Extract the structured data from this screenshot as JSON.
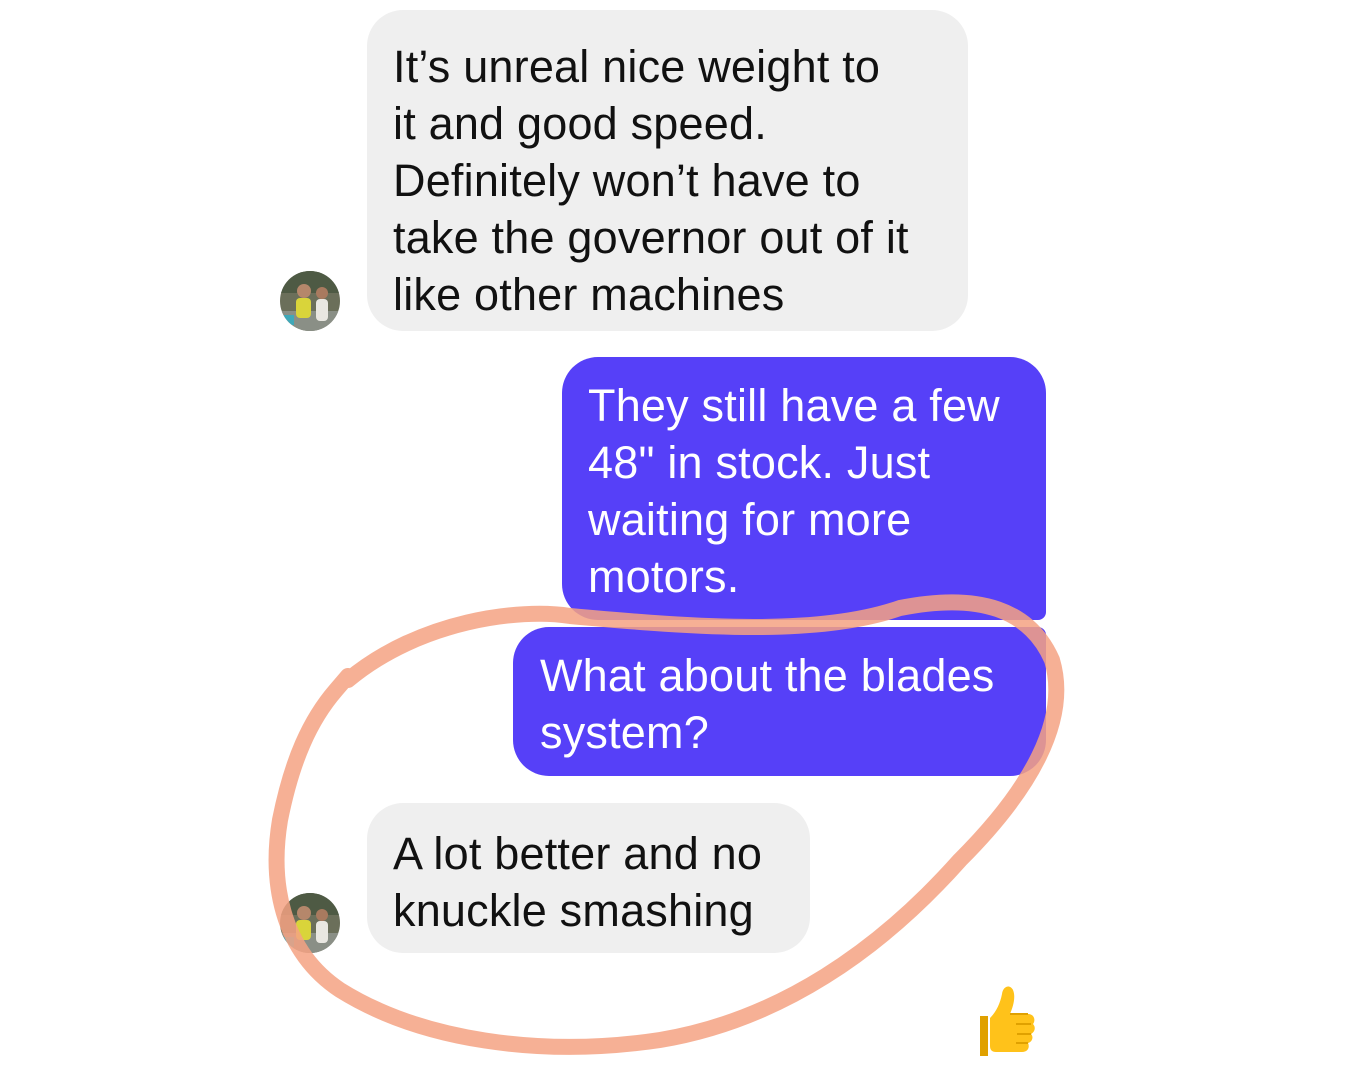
{
  "conversation": {
    "messages": [
      {
        "sender": "contact",
        "text": "It’s unreal nice weight to\nit and good speed.\nDefinitely won’t have to\ntake the governor out of it\nlike other machines"
      },
      {
        "sender": "me",
        "text": "They still have a few\n48\" in stock. Just\nwaiting for more\nmotors."
      },
      {
        "sender": "me",
        "text": "What about the blades\nsystem?"
      },
      {
        "sender": "contact",
        "text": "A lot better and no\nknuckle smashing"
      }
    ],
    "reaction": "👍"
  },
  "colors": {
    "incoming_bubble": "#efefef",
    "outgoing_bubble": "#5640f8",
    "annotation_circle": "#f5a283"
  },
  "icons": {
    "avatar": "contact-avatar",
    "reaction": "thumbs-up-icon"
  }
}
